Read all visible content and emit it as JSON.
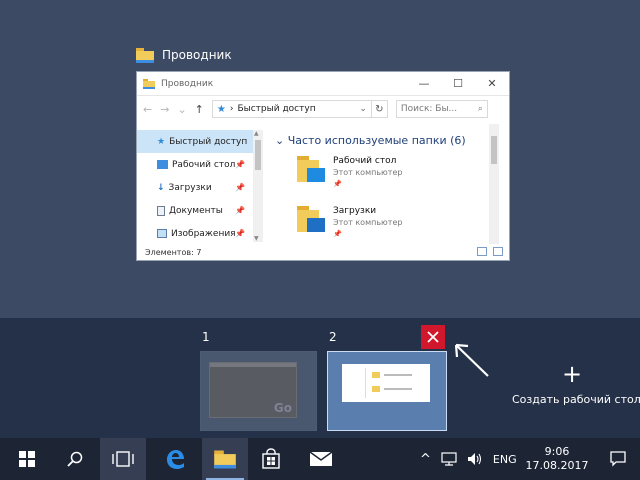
{
  "window_caption": {
    "title": "Проводник",
    "icon": "file-explorer-icon"
  },
  "explorer": {
    "title": "Проводник",
    "controls": {
      "minimize": "—",
      "maximize": "☐",
      "close": "✕"
    },
    "nav": {
      "back": "←",
      "forward": "→",
      "dropdown": "⌄",
      "up": "↑"
    },
    "address": {
      "separator": "›",
      "path": "Быстрый доступ",
      "dropdown": "⌄",
      "refresh": "↻"
    },
    "search_placeholder": "Поиск: Бы...",
    "search_icon": "⌕",
    "sidebar": [
      {
        "label": "Быстрый доступ",
        "icon": "star-icon",
        "pinned": false,
        "selected": true
      },
      {
        "label": "Рабочий стол",
        "icon": "desktop-folder-icon",
        "pinned": true
      },
      {
        "label": "Загрузки",
        "icon": "download-icon",
        "pinned": true
      },
      {
        "label": "Документы",
        "icon": "documents-icon",
        "pinned": true
      },
      {
        "label": "Изображения",
        "icon": "pictures-icon",
        "pinned": true
      }
    ],
    "group_header": "Часто используемые папки (6)",
    "group_chevron": "⌄",
    "folders": [
      {
        "name": "Рабочий стол",
        "location": "Этот компьютер"
      },
      {
        "name": "Загрузки",
        "location": "Этот компьютер"
      }
    ],
    "status": "Элементов: 7"
  },
  "desktops": [
    {
      "number": "1",
      "active": false
    },
    {
      "number": "2",
      "active": true
    }
  ],
  "mini_watermark": "Go",
  "close_desktop_icon": "close-icon",
  "new_desktop": {
    "plus": "+",
    "label": "Создать рабочий стол"
  },
  "taskbar": {
    "start_icon": "windows-logo-icon",
    "search_icon": "search-icon",
    "taskview_icon": "task-view-icon",
    "apps": [
      "edge-icon",
      "file-explorer-icon",
      "store-icon",
      "mail-icon"
    ],
    "tray": {
      "chevron": "^",
      "language": "ENG"
    },
    "time": "9:06",
    "date": "17.08.2017"
  },
  "colors": {
    "accent": "#0078d7",
    "close_red": "#d0172b",
    "active_desktop": "#5a7fae"
  }
}
